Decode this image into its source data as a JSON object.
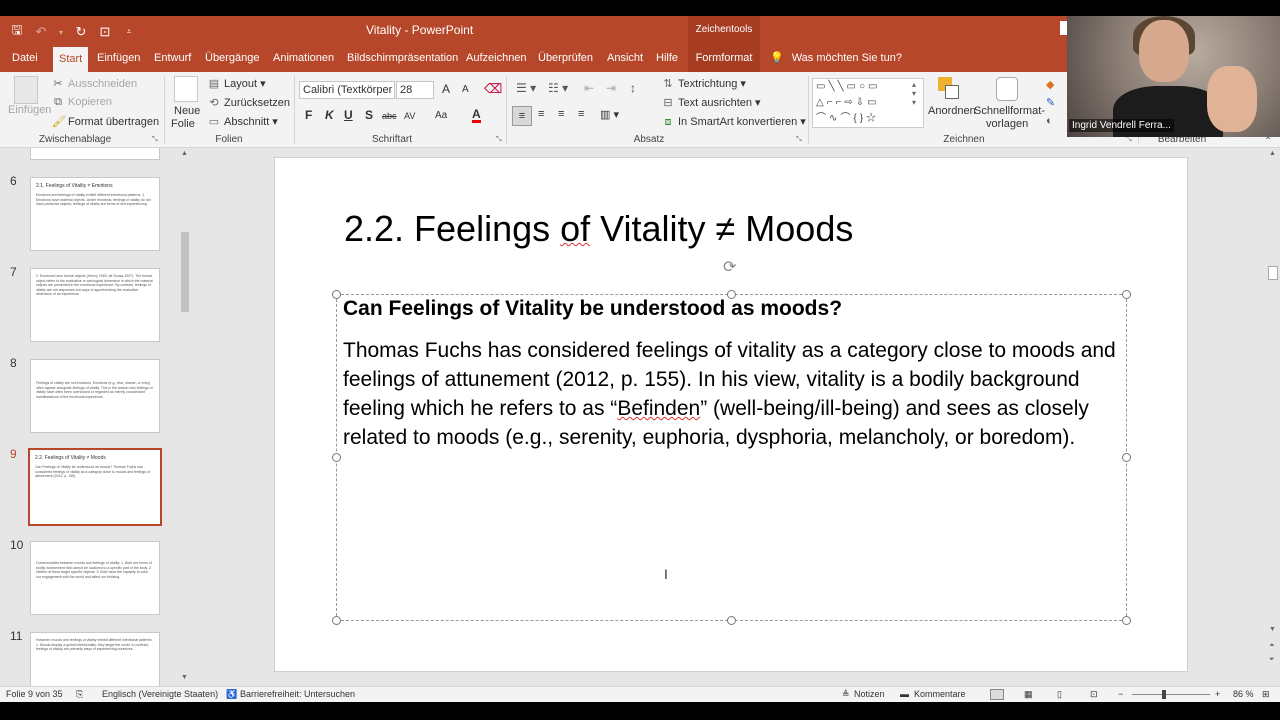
{
  "window": {
    "title": "Vitality  -  PowerPoint",
    "context_tools": "Zeichentools"
  },
  "tabs": [
    "Datei",
    "Start",
    "Einfügen",
    "Entwurf",
    "Übergänge",
    "Animationen",
    "Bildschirmpräsentation",
    "Aufzeichnen",
    "Überprüfen",
    "Ansicht",
    "Hilfe",
    "Formformat"
  ],
  "active_tab": "Start",
  "tell_me": "Was möchten Sie tun?",
  "ribbon": {
    "clipboard": {
      "paste": "Einfügen",
      "cut": "Ausschneiden",
      "copy": "Kopieren",
      "format_painter": "Format übertragen",
      "label": "Zwischenablage"
    },
    "slides": {
      "new_slide_line1": "Neue",
      "new_slide_line2": "Folie",
      "layout": "Layout",
      "reset": "Zurücksetzen",
      "section": "Abschnitt",
      "label": "Folien"
    },
    "font": {
      "family": "Calibri (Textkörper",
      "size": "28",
      "bold": "F",
      "italic": "K",
      "underline": "U",
      "shadow": "S",
      "strike": "abc",
      "spacing": "AV",
      "case": "Aa",
      "grow": "A",
      "shrink": "A",
      "color": "A",
      "label": "Schriftart"
    },
    "paragraph": {
      "text_direction": "Textrichtung",
      "align_text": "Text ausrichten",
      "smartart": "In SmartArt konvertieren",
      "label": "Absatz"
    },
    "drawing": {
      "arrange": "Anordnen",
      "quick_styles_line1": "Schnellformat-",
      "quick_styles_line2": "vorlagen",
      "label": "Zeichnen"
    },
    "editing": {
      "label": "Bearbeiten"
    }
  },
  "thumbnails": [
    {
      "num": "6",
      "title": "2.1. Feelings of Vitality ≠ Emotions",
      "body": "Emotions and feelings of vitality exhibit different intentional patterns. 1. Emotions have material objects. Under emotions, feelings of vitality do not have particular objects; feelings of vitality are forms of self-experiencing."
    },
    {
      "num": "7",
      "title": "",
      "body": "2. Emotions have formal objects (Kenny 1963; de Sousa 2007). The formal object refers to the evaluative or axiological dimension in which the material objects are presented in the emotional experience. By contrast, feelings of vitality are not responses but ways of apprehending the evaluative dimension of an experience."
    },
    {
      "num": "8",
      "title": "",
      "body": "Feelings of vitality are not emotions. Emotions (e.g., fear, shame, or envy) often appear alongside feelings of vitality. This is the reason why feelings of vitality have often been overlooked or regarded as merely concomitant manifestations of the emotional experience."
    },
    {
      "num": "9",
      "title": "2.2. Feelings of Vitality ≠ Moods",
      "body": "Can Feelings of Vitality be understood as moods? Thomas Fuchs has considered feelings of vitality as a category close to moods and feelings of attunement (2012, p. 155)."
    },
    {
      "num": "10",
      "title": "",
      "body": "Commonalities between moods and feelings of vitality: 1. Both are forms of bodily involvement that cannot be localized to a specific part of the body. 2. Neither of them target specific objects. 3. Both have the capacity to color our engagement with the world and affect our thinking."
    },
    {
      "num": "11",
      "title": "",
      "body": "However, moods and feelings of vitality exhibit different intentional patterns. 1. Moods display a global intentionality: they target the world. In contrast, feelings of vitality are primarily ways of experiencing ourselves."
    }
  ],
  "slide": {
    "title_pre": "2.2. Feelings ",
    "title_of": "of",
    "title_post": " Vitality ≠ Moods",
    "question": "Can Feelings of Vitality be understood as moods?",
    "para_pre": "Thomas Fuchs has considered feelings of vitality as a category close to moods and feelings of attunement (2012, p. 155). In his view, vitality is a bodily background feeling which he refers to as “",
    "para_befinden": "Befinden",
    "para_post": "” (well-being/ill-being) and sees as closely related to moods (e.g., serenity, euphoria, dysphoria, melancholy, or boredom)."
  },
  "status": {
    "slide_counter": "Folie 9 von 35",
    "language": "Englisch (Vereinigte Staaten)",
    "accessibility": "Barrierefreiheit: Untersuchen",
    "notes": "Notizen",
    "comments": "Kommentare",
    "zoom": "86 %"
  },
  "video": {
    "participant": "Ingrid Vendrell Ferra..."
  },
  "colors": {
    "accent": "#b7472a",
    "ribbon": "#f3f3f3"
  }
}
